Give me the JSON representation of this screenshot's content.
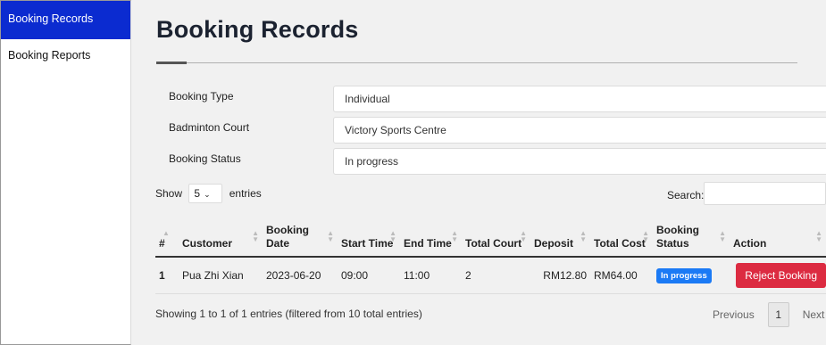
{
  "sidebar": {
    "items": [
      {
        "label": "Booking Records",
        "active": true
      },
      {
        "label": "Booking Reports",
        "active": false
      }
    ]
  },
  "page_title": "Booking Records",
  "filters": [
    {
      "label": "Booking Type",
      "value": "Individual"
    },
    {
      "label": "Badminton Court",
      "value": "Victory Sports Centre"
    },
    {
      "label": "Booking Status",
      "value": "In progress"
    }
  ],
  "table_controls": {
    "show_prefix": "Show",
    "page_length": "5",
    "show_suffix": "entries",
    "search_label": "Search:"
  },
  "table": {
    "columns": [
      "#",
      "Customer",
      "Booking Date",
      "Start Time",
      "End Time",
      "Total Court",
      "Deposit",
      "Total Cost",
      "Booking Status",
      "Action"
    ],
    "rows": [
      {
        "no": "1",
        "customer": "Pua Zhi Xian",
        "booking_date": "2023-06-20",
        "start_time": "09:00",
        "end_time": "11:00",
        "total_court": "2",
        "deposit": "RM12.80",
        "total_cost": "RM64.00",
        "status": "In progress",
        "action": "Reject Booking"
      }
    ]
  },
  "info_text": "Showing 1 to 1 of 1 entries (filtered from 10 total entries)",
  "pagination": {
    "previous": "Previous",
    "current": "1",
    "next": "Next"
  },
  "colors": {
    "sidebar_active": "#0b2bd0",
    "badge": "#1b7af5",
    "reject": "#dc2b41"
  }
}
